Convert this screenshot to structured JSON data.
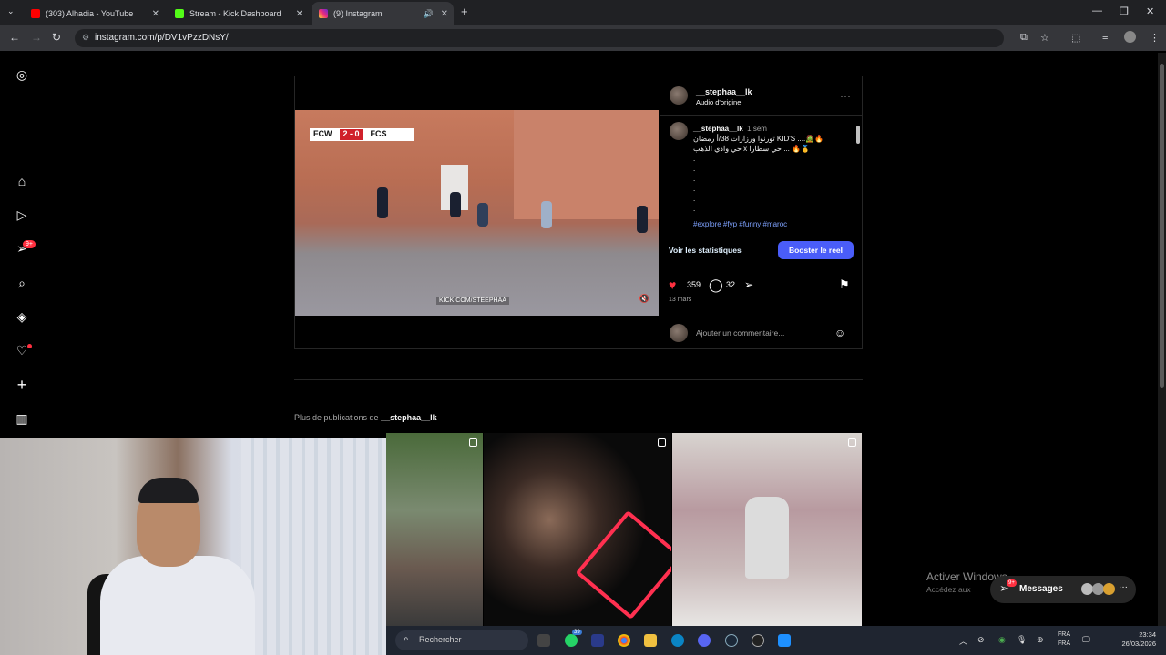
{
  "browser": {
    "tabs": [
      {
        "title": "(303) Alhadia - YouTube",
        "favicon_color": "#ff0000"
      },
      {
        "title": "Stream - Kick Dashboard",
        "favicon_color": "#53fc18"
      },
      {
        "title": "(9) Instagram",
        "favicon_color": "#e1306c"
      }
    ],
    "new_tab": "+",
    "url": "instagram.com/p/DV1vPzzDNsY/"
  },
  "sidebar": {
    "notifications_badge": "9+"
  },
  "post": {
    "username": "__stephaa__lk",
    "audio": "Audio d'origine",
    "video": {
      "score_left": "FCW",
      "score": "2 - 0",
      "score_right": "FCS",
      "watermark": "KICK.COM/STEEPHAA"
    },
    "caption": {
      "username": "__stephaa__lk",
      "time": "1 sem",
      "line1": "تورنوا ورزازات 38/أ رمضان KID'S ....🧟🔥",
      "line2": "حي وادي الذهب x حي سطارا ... 🔥🥇",
      "dots": [
        ".",
        ".",
        ".",
        ".",
        ".",
        "."
      ],
      "hashtags": "#explore #fyp #funny #maroc"
    },
    "stats_link": "Voir les statistiques",
    "boost_button": "Booster le reel",
    "likes": "359",
    "comments": "32",
    "date": "13 mars",
    "comment_placeholder": "Ajouter un commentaire..."
  },
  "more_posts": {
    "prefix": "Plus de publications de",
    "username": "__stephaa__lk"
  },
  "overlay": {
    "activate_title": "Activer Windows",
    "activate_sub": "Accédez aux",
    "messages_label": "Messages",
    "messages_badge": "9+"
  },
  "taskbar": {
    "search_placeholder": "Rechercher",
    "whatsapp_badge": "39",
    "lang1": "FRA",
    "lang2": "FRA",
    "time": "23:34",
    "date": "26/03/2026"
  }
}
